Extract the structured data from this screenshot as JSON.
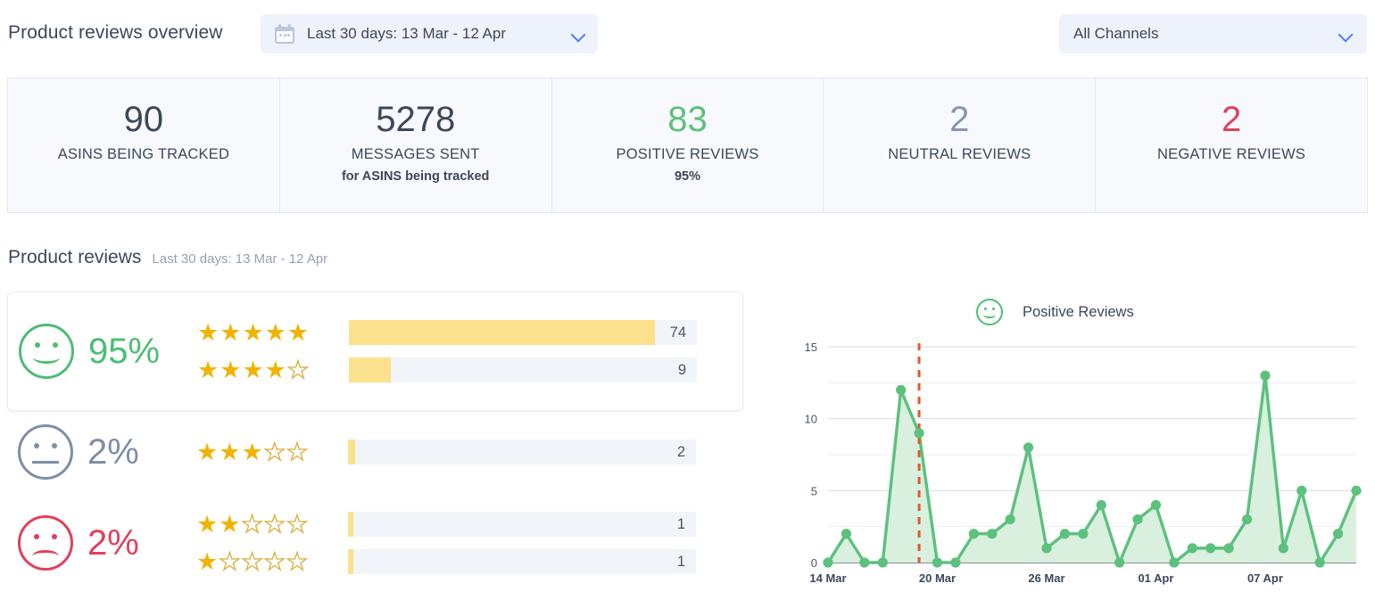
{
  "header": {
    "title": "Product reviews overview",
    "date_picker": {
      "icon": "calendar-icon",
      "label": "Last 30 days: 13 Mar - 12 Apr",
      "chevron": "chevron-down-icon"
    },
    "channel_picker": {
      "label": "All Channels",
      "chevron": "chevron-down-icon"
    }
  },
  "stats": [
    {
      "value": "90",
      "label": "ASINS BEING TRACKED",
      "sub": "",
      "color": "#3c4858"
    },
    {
      "value": "5278",
      "label": "MESSAGES SENT",
      "sub": "for ASINS being tracked",
      "color": "#3c4858"
    },
    {
      "value": "83",
      "label": "POSITIVE REVIEWS",
      "sub": "95%",
      "color": "#5cc17d"
    },
    {
      "value": "2",
      "label": "NEUTRAL REVIEWS",
      "sub": "",
      "color": "#8a96a8"
    },
    {
      "value": "2",
      "label": "NEGATIVE REVIEWS",
      "sub": "",
      "color": "#e0405c"
    }
  ],
  "section": {
    "title": "Product reviews",
    "subtitle": "Last 30 days: 13 Mar - 12 Apr"
  },
  "reviews": {
    "positive": {
      "percent": "95%",
      "face": "smiley-happy-icon",
      "color": "#4cbd73",
      "rows": [
        {
          "stars": 5,
          "count": "74",
          "fill_pct": 88
        },
        {
          "stars": 4,
          "count": "9",
          "fill_pct": 12
        }
      ]
    },
    "neutral": {
      "percent": "2%",
      "face": "smiley-neutral-icon",
      "color": "#7f8ea4",
      "rows": [
        {
          "stars": 3,
          "count": "2",
          "fill_pct": 2
        }
      ]
    },
    "negative": {
      "percent": "2%",
      "face": "smiley-sad-icon",
      "color": "#e0405c",
      "rows": [
        {
          "stars": 2,
          "count": "1",
          "fill_pct": 1.5
        },
        {
          "stars": 1,
          "count": "1",
          "fill_pct": 1.5
        }
      ]
    }
  },
  "chart_legend": {
    "icon": "smiley-happy-icon",
    "label": "Positive Reviews"
  },
  "chart_data": {
    "type": "area",
    "title": "Positive Reviews",
    "xlabel": "",
    "ylabel": "",
    "ylim": [
      0,
      15
    ],
    "yticks": [
      0,
      5,
      10,
      15
    ],
    "ytick_labels": [
      "0",
      "5",
      "10",
      "15"
    ],
    "grid": true,
    "legend_position": "top-center",
    "line_color": "#5cc17d",
    "fill_color": "#d9f0de",
    "marker_color": "#5cc17d",
    "annotation": {
      "type": "vertical-dashed-line",
      "x": "19 Mar",
      "color": "#e05a2b"
    },
    "x": [
      "14 Mar",
      "15 Mar",
      "16 Mar",
      "17 Mar",
      "18 Mar",
      "19 Mar",
      "20 Mar",
      "21 Mar",
      "22 Mar",
      "23 Mar",
      "24 Mar",
      "25 Mar",
      "26 Mar",
      "27 Mar",
      "28 Mar",
      "29 Mar",
      "30 Mar",
      "31 Mar",
      "01 Apr",
      "02 Apr",
      "03 Apr",
      "04 Apr",
      "05 Apr",
      "06 Apr",
      "07 Apr",
      "08 Apr",
      "09 Apr",
      "10 Apr",
      "11 Apr",
      "12 Apr"
    ],
    "xtick_labels": [
      "14 Mar",
      "20 Mar",
      "26 Mar",
      "01 Apr",
      "07 Apr"
    ],
    "xtick_indices": [
      0,
      6,
      12,
      18,
      24
    ],
    "values": [
      0,
      2,
      0,
      0,
      12,
      9,
      0,
      0,
      2,
      2,
      3,
      8,
      1,
      2,
      2,
      4,
      0,
      3,
      4,
      0,
      1,
      1,
      1,
      3,
      13,
      1,
      5,
      0,
      2,
      5
    ],
    "series": [
      {
        "name": "Positive Reviews",
        "values": [
          0,
          2,
          0,
          0,
          12,
          9,
          0,
          0,
          2,
          2,
          3,
          8,
          1,
          2,
          2,
          4,
          0,
          3,
          4,
          0,
          1,
          1,
          1,
          3,
          13,
          1,
          5,
          0,
          2,
          5
        ]
      }
    ]
  }
}
